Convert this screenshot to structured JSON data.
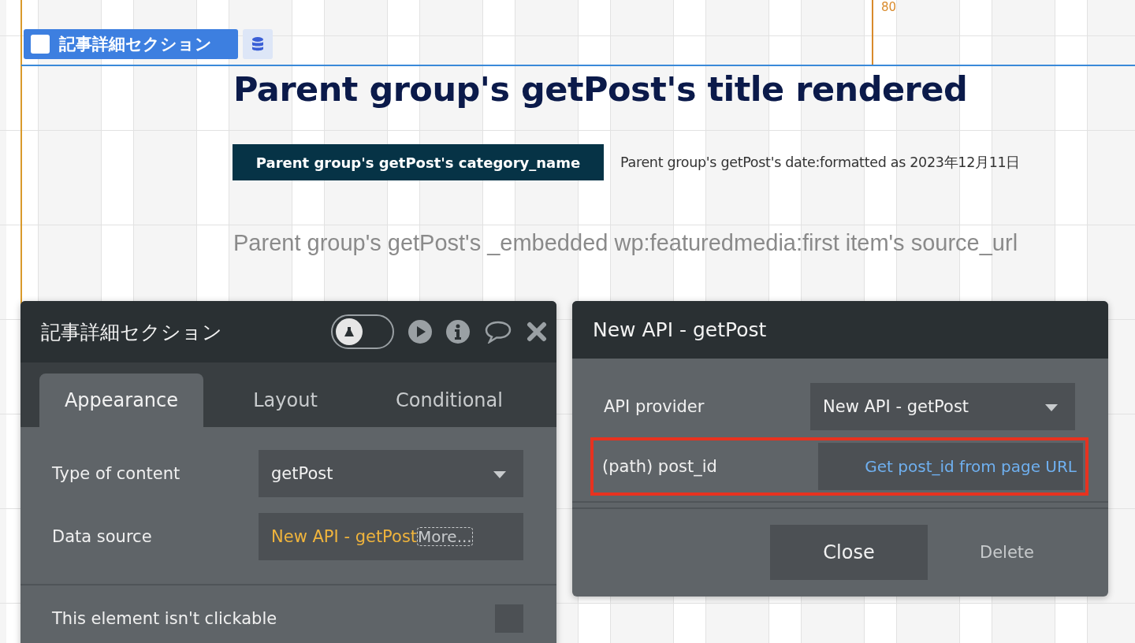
{
  "canvas": {
    "ruler_marker": "80",
    "section_tag": {
      "label": "記事詳細セクション"
    },
    "title": "Parent group's getPost's title rendered",
    "category": "Parent group's getPost's category_name",
    "date": "Parent group's getPost's date:formatted as 2023年12月11日",
    "image_url": "Parent group's getPost's _embedded wp:featuredmedia:first item's source_url"
  },
  "property_editor": {
    "title": "記事詳細セクション",
    "inspect_toggle": {
      "on": false
    },
    "tabs": [
      {
        "label": "Appearance",
        "selected": true
      },
      {
        "label": "Layout",
        "selected": false
      },
      {
        "label": "Conditional",
        "selected": false
      }
    ],
    "fields": [
      {
        "kind": "dropdown",
        "label": "Type of content",
        "value": "getPost"
      },
      {
        "kind": "expression",
        "label": "Data source",
        "value": "New API - getPost",
        "more": "More..."
      },
      {
        "kind": "checkbox",
        "label": "This element isn't clickable",
        "checked": false
      }
    ]
  },
  "api_editor": {
    "title": "New API - getPost",
    "fields": [
      {
        "kind": "dropdown",
        "label": "API provider",
        "value": "New API - getPost",
        "highlighted": false
      },
      {
        "kind": "link",
        "label": "(path) post_id",
        "value": "Get post_id from page URL",
        "highlighted": true
      }
    ],
    "buttons": [
      {
        "label": "Close",
        "kind": "primary"
      },
      {
        "label": "Delete",
        "kind": "plain"
      }
    ]
  }
}
